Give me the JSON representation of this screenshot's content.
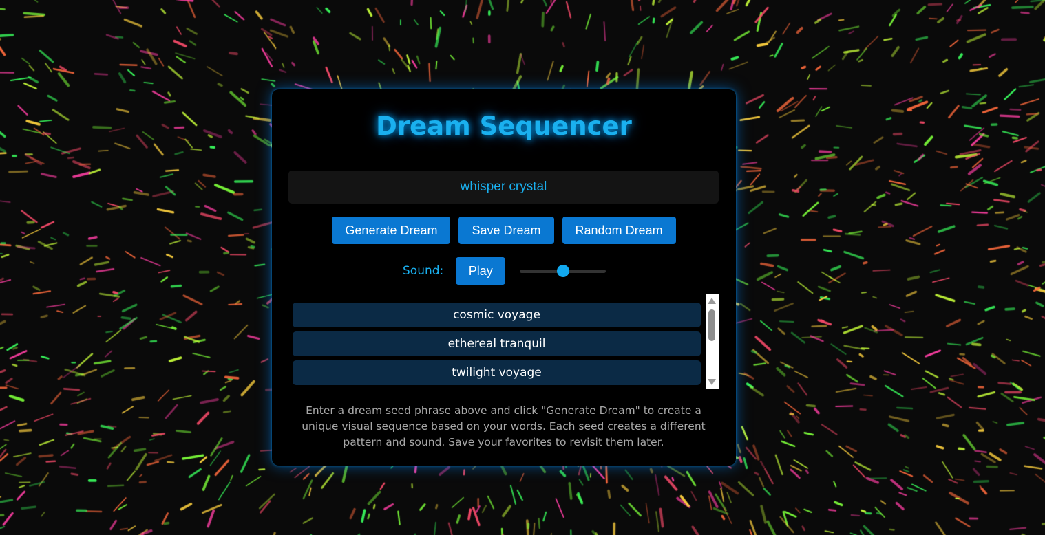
{
  "app": {
    "title": "Dream Sequencer",
    "accent_color": "#1ab0ef",
    "button_color": "#0a78d2"
  },
  "seed_input": {
    "value": "whisper crystal",
    "placeholder": ""
  },
  "buttons": {
    "generate": "Generate Dream",
    "save": "Save Dream",
    "random": "Random Dream"
  },
  "sound": {
    "label": "Sound:",
    "play": "Play",
    "volume": 0.5
  },
  "saved_dreams": [
    "cosmic voyage",
    "ethereal tranquil",
    "twilight voyage"
  ],
  "description": "Enter a dream seed phrase above and click \"Generate Dream\" to create a unique visual sequence based on your words. Each seed creates a different pattern and sound. Save your favorites to revisit them later.",
  "background": {
    "colors": [
      "#ff4d6d",
      "#ffd23f",
      "#7dff3a",
      "#3aff5e",
      "#ff6b3d",
      "#ff3fa4",
      "#c8ff3a"
    ]
  }
}
